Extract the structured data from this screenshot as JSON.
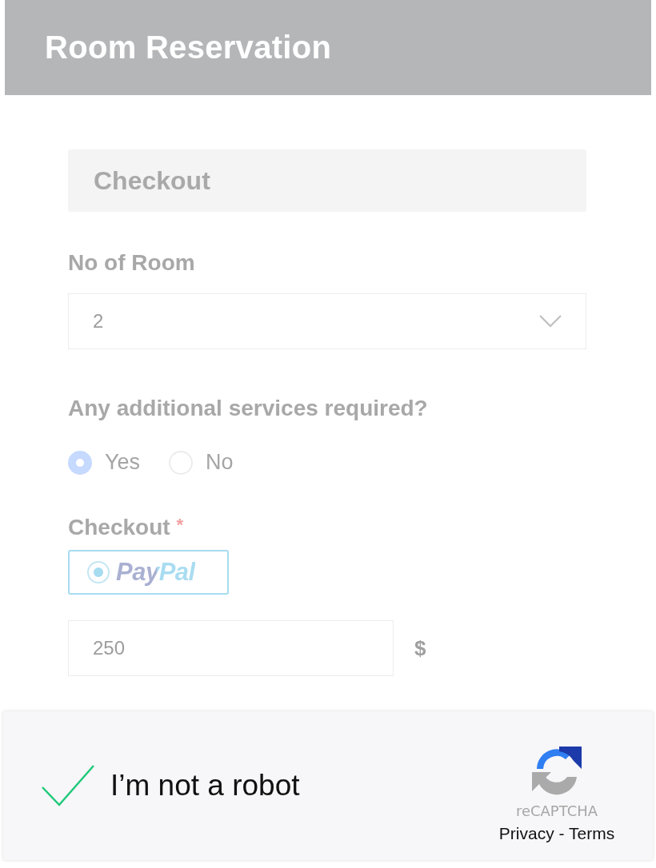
{
  "header": {
    "title": "Room Reservation"
  },
  "section": {
    "title": "Checkout"
  },
  "rooms": {
    "label": "No of Room",
    "value": "2"
  },
  "services": {
    "question": "Any additional services required?",
    "options": [
      {
        "label": "Yes",
        "selected": true
      },
      {
        "label": "No",
        "selected": false
      }
    ]
  },
  "checkout": {
    "label": "Checkout",
    "required_mark": "*",
    "methods": [
      {
        "label": "PayPal",
        "selected": true
      }
    ],
    "amount": "250",
    "currency": "$"
  },
  "captcha": {
    "checked": true,
    "label": "I’m not a robot",
    "brand": "reCAPTCHA",
    "links": "Privacy - Terms"
  }
}
